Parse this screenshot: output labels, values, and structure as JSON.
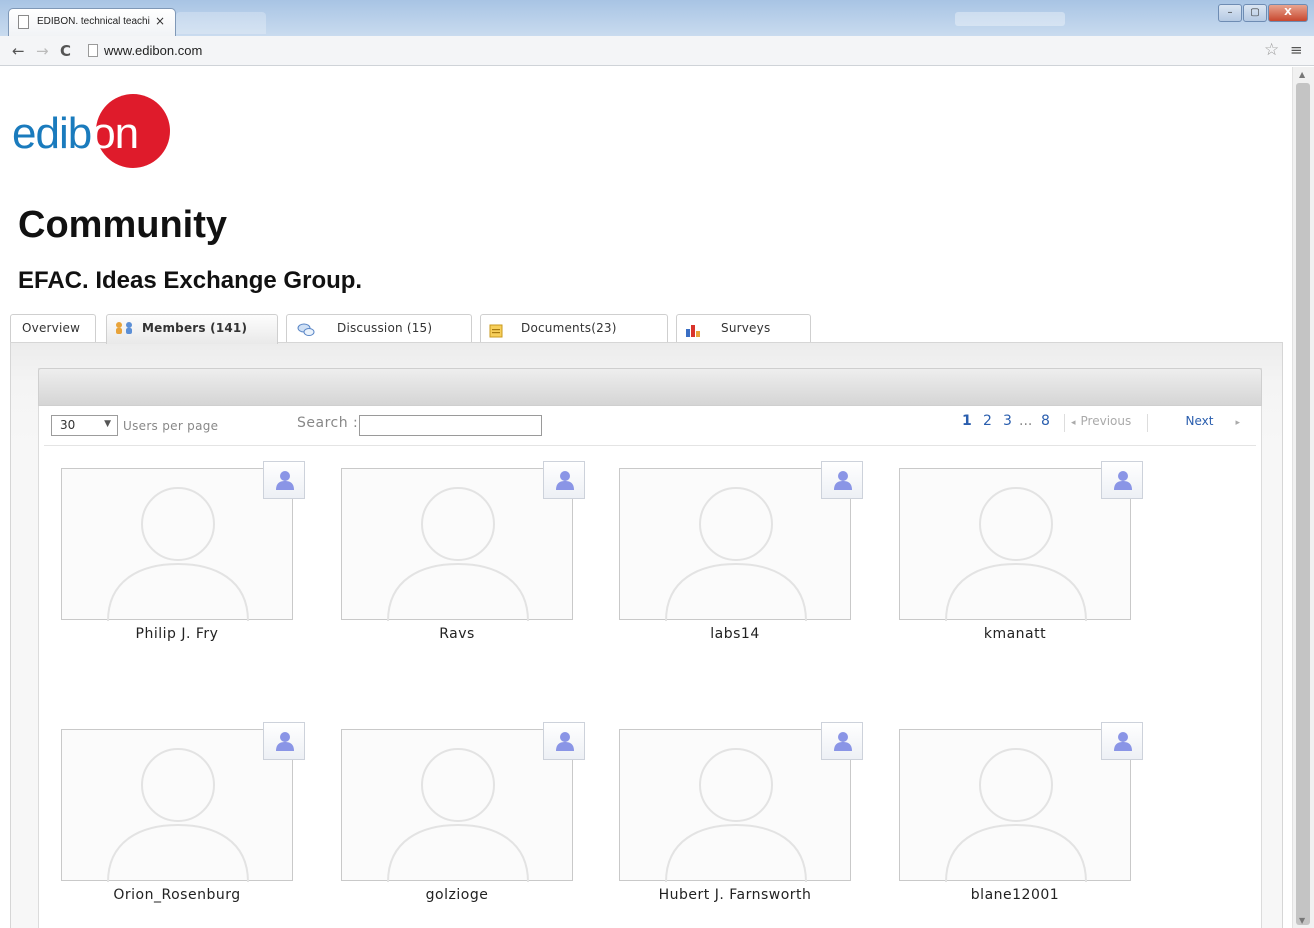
{
  "browser": {
    "tab_title": "EDIBON. technical teachi",
    "tab_close": "×",
    "url": "www.edibon.com",
    "nav_back": "←",
    "nav_forward": "→",
    "nav_reload": "C",
    "star": "☆",
    "menu": "≡",
    "window_buttons": {
      "minimize": "–",
      "maximize": "▢",
      "close": "X"
    }
  },
  "logo": {
    "text_blue": "edib",
    "text_white": "on",
    "brand_red": "#df1b2b",
    "brand_blue": "#1a7bbd"
  },
  "page": {
    "title": "Community",
    "group_title": "EFAC. Ideas Exchange Group."
  },
  "tabs": [
    {
      "label": "Overview",
      "icon": "none",
      "active": false
    },
    {
      "label": "Members (141)",
      "icon": "members-icon",
      "active": true
    },
    {
      "label": "Discussion (15)",
      "icon": "discussion-icon",
      "active": false
    },
    {
      "label": "Documents(23)",
      "icon": "documents-icon",
      "active": false
    },
    {
      "label": "Surveys",
      "icon": "surveys-icon",
      "active": false
    }
  ],
  "controls": {
    "per_page_value": "30",
    "per_page_arrow": "▼",
    "per_page_label": "Users per page",
    "search_label": "Search :",
    "search_value": ""
  },
  "pagination": {
    "pages": [
      "1",
      "2",
      "3",
      "...",
      "8"
    ],
    "current": "1",
    "previous_label": "Previous",
    "previous_arrow": "◂",
    "next_label": "Next",
    "next_arrow": "▸"
  },
  "members": [
    {
      "name": "Philip J. Fry"
    },
    {
      "name": "Ravs"
    },
    {
      "name": "labs14"
    },
    {
      "name": "kmanatt"
    },
    {
      "name": "Orion_Rosenburg"
    },
    {
      "name": "golzioge"
    },
    {
      "name": "Hubert J. Farnsworth"
    },
    {
      "name": "blane12001"
    }
  ]
}
